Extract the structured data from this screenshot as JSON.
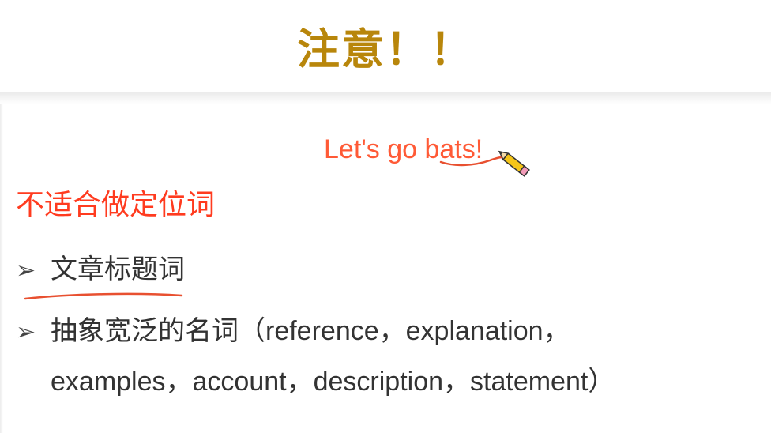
{
  "slide": {
    "title": "注意！！",
    "annotation": "Let's go bats!",
    "heading": "不适合做定位词",
    "bullets": [
      {
        "marker": "➢",
        "text": "文章标题词"
      },
      {
        "marker": "➢",
        "text": "抽象宽泛的名词（reference，explanation，"
      }
    ],
    "continuation": "examples，account，description，statement）"
  },
  "colors": {
    "title": "#b8860b",
    "annotation": "#ff5a36",
    "heading": "#ff3b1f",
    "body_text": "#333333",
    "pen_mark": "#e85030"
  },
  "icons": {
    "cursor": "pencil-cursor-icon"
  }
}
